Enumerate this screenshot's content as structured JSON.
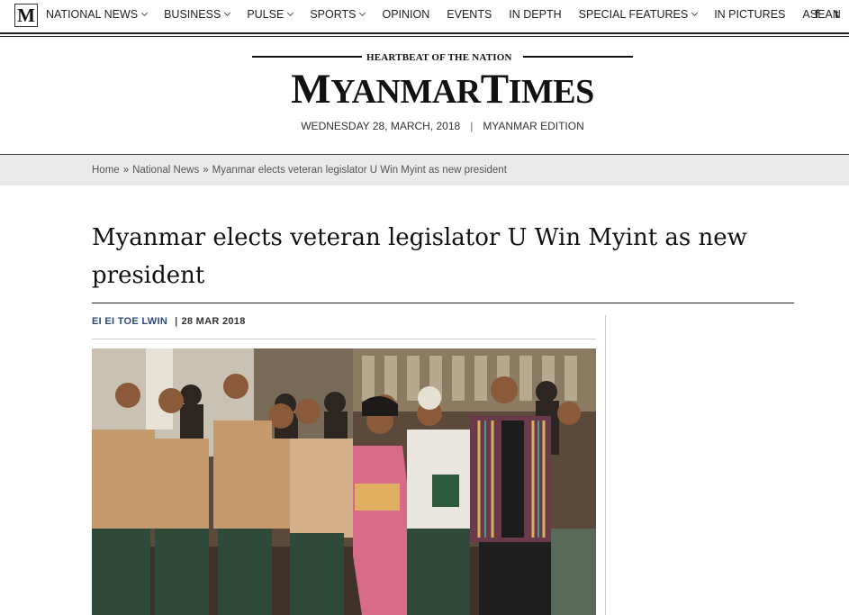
{
  "nav": {
    "logo_letter": "M",
    "items": [
      {
        "label": "NATIONAL NEWS",
        "dropdown": true
      },
      {
        "label": "BUSINESS",
        "dropdown": true
      },
      {
        "label": "PULSE",
        "dropdown": true
      },
      {
        "label": "SPORTS",
        "dropdown": true
      },
      {
        "label": "OPINION",
        "dropdown": false
      },
      {
        "label": "EVENTS",
        "dropdown": false
      },
      {
        "label": "IN DEPTH",
        "dropdown": false
      },
      {
        "label": "SPECIAL FEATURES",
        "dropdown": true
      },
      {
        "label": "IN PICTURES",
        "dropdown": false
      },
      {
        "label": "ASEAN",
        "dropdown": false
      }
    ],
    "social": {
      "facebook": "f",
      "twitter": "t"
    }
  },
  "masthead": {
    "tagline": "HEARTBEAT OF THE NATION",
    "brand_parts": [
      "M",
      "YANMAR",
      "T",
      "IMES"
    ],
    "date": "WEDNESDAY 28, MARCH, 2018",
    "date_sep": "|",
    "edition": "MYANMAR EDITION"
  },
  "breadcrumb": {
    "home": "Home",
    "section": "National News",
    "current": "Myanmar elects veteran legislator U Win Myint as new president",
    "sep": "»"
  },
  "article": {
    "headline": "Myanmar elects veteran legislator U Win Myint as new president",
    "author": "EI EI TOE LWIN",
    "byline_sep": "|",
    "date": "28 MAR 2018"
  },
  "colors": {
    "author": "#2a4a7a",
    "crumb_bg": "#eaeaea",
    "text": "#111111"
  }
}
